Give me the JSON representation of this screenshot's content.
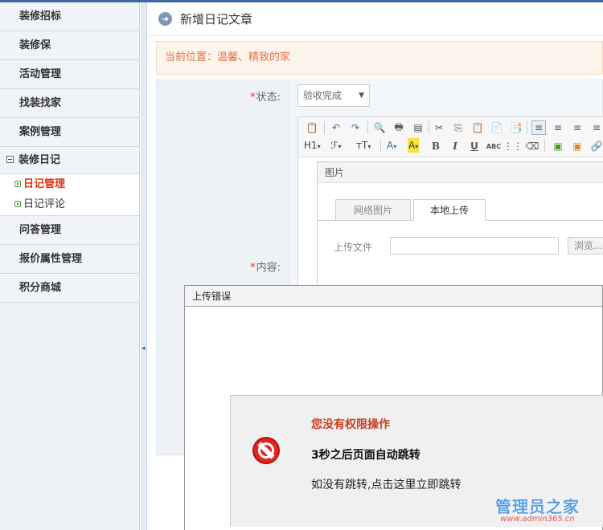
{
  "sidebar": {
    "items_top": [
      "装修招标",
      "装修保",
      "活动管理",
      "找装找家",
      "案例管理"
    ],
    "group": {
      "label": "装修日记",
      "subitems": [
        "日记管理",
        "日记评论"
      ]
    },
    "items_bottom": [
      "问答管理",
      "报价属性管理",
      "积分商城"
    ]
  },
  "splitter": {
    "arrow": "◂"
  },
  "header": {
    "title": "新增日记文章",
    "icon": "circle-arrow-icon"
  },
  "location": {
    "text": "当前位置：温馨、精致的家"
  },
  "form": {
    "status_label": "状态:",
    "status_value": "验收完成",
    "content_label": "内容:",
    "required_mark": "*"
  },
  "editor": {
    "toolbar_row2_heading": "H1",
    "toolbar_row2_font": "ℱ",
    "toolbar_row2_size": "ᴛT",
    "bold": "B",
    "italic": "I",
    "underline": "U",
    "strike": "ABC"
  },
  "image_dialog": {
    "title": "图片",
    "tabs": [
      "网络图片",
      "本地上传"
    ],
    "active_tab": "本地上传",
    "upload_label": "上传文件",
    "browse_label": "浏览..."
  },
  "error_popup": {
    "title": "上传错误",
    "message_title": "您没有权限操作",
    "message_main": "3秒之后页面自动跳转",
    "message_link": "如没有跳转,点击这里立即跳转"
  },
  "watermark": {
    "main": "管理员之家",
    "url": "www.admin365.cn"
  },
  "colors": {
    "accent": "#3a6a9e",
    "error": "#d13a1b",
    "active_menu": "#e53312",
    "location_text": "#e8714a"
  }
}
